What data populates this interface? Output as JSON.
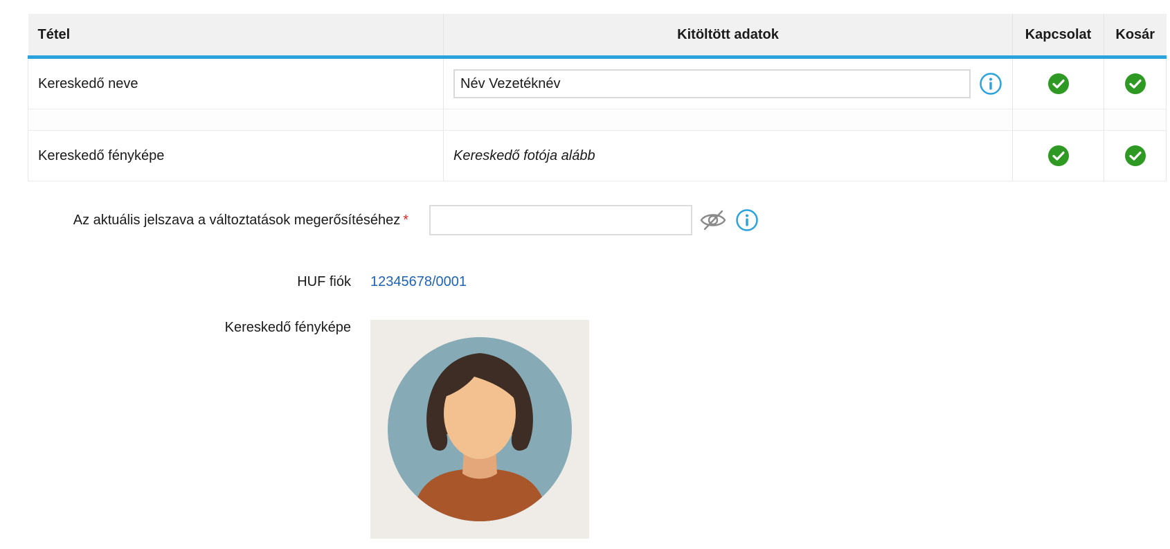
{
  "table": {
    "headers": {
      "item": "Tétel",
      "filled": "Kitöltött adatok",
      "contact": "Kapcsolat",
      "cart": "Kosár"
    },
    "rows": [
      {
        "item": "Kereskedő neve",
        "value": "Név Vezetéknév"
      },
      {
        "item": "Kereskedő fényképe",
        "value": "Kereskedő fotója alább"
      }
    ]
  },
  "password": {
    "label": "Az aktuális jelszava a változtatások megerősítéséhez",
    "required_mark": "*",
    "value": ""
  },
  "account": {
    "label": "HUF fiók",
    "value": "12345678/0001"
  },
  "photo": {
    "label": "Kereskedő fényképe"
  },
  "colors": {
    "accent": "#2aa3dc",
    "check": "#2f9a23",
    "link": "#1e63b8",
    "required": "#d42a2a"
  },
  "icons": [
    "info-icon",
    "check-icon",
    "eye-slash-icon",
    "avatar-placeholder"
  ]
}
